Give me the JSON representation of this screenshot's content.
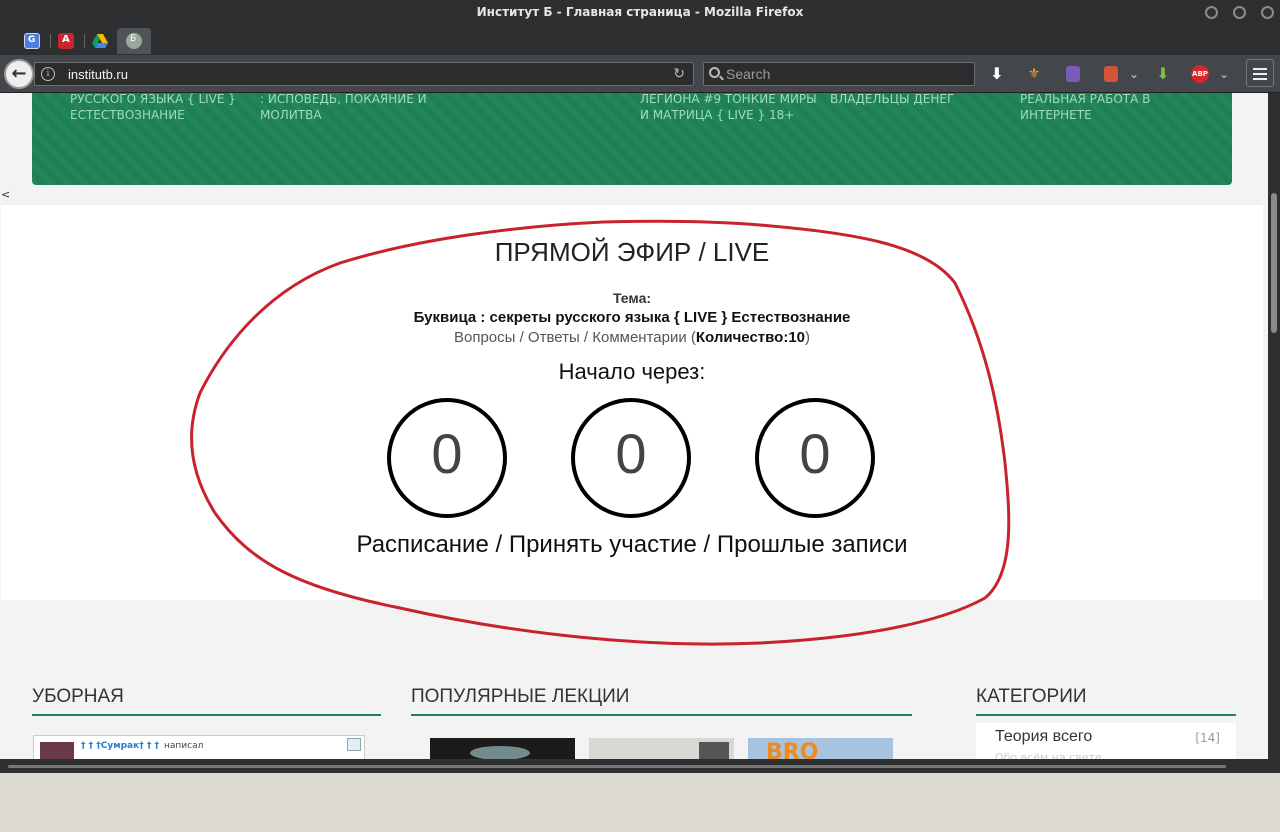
{
  "window": {
    "title": "Институт Б - Главная страница - Mozilla Firefox"
  },
  "tabs": [
    {
      "icon": "google-translate-icon"
    },
    {
      "icon": "acrobat-icon"
    },
    {
      "icon": "google-drive-icon"
    },
    {
      "icon": "site-favicon",
      "active": true
    }
  ],
  "toolbar": {
    "url": "institutb.ru",
    "search_placeholder": "Search",
    "icons": [
      "download-icon",
      "extension-icon",
      "extension-icon",
      "extension-icon",
      "download-helper-icon",
      "adblock-icon",
      "menu-icon"
    ],
    "adblock_label": "ABP"
  },
  "banner": {
    "items": [
      "РУССКОГО ЯЗЫКА { LIVE } ЕСТЕСТВОЗНАНИЕ",
      ": ИСПОВЕДЬ, ПОКАЯНИЕ И МОЛИТВА",
      "ЛЕГИОНА #9 ТОНКИЕ МИРЫ И МАТРИЦА { LIVE } 18+",
      "ВЛАДЕЛЬЦЫ ДЕНЕГ",
      "РЕАЛЬНАЯ РАБОТА В ИНТЕРНЕТЕ"
    ],
    "prev_arrow": "<"
  },
  "live": {
    "title": "ПРЯМОЙ ЭФИР / LIVE",
    "theme_label": "Тема:",
    "theme": "Буквица : секреты русского языка { LIVE } Естествознание",
    "qa_text": "Вопросы / Ответы / Комментарии (",
    "qa_count": "Количество:10",
    "qa_close": ")",
    "starts_in": "Начало через:",
    "counters": [
      "0",
      "0",
      "0"
    ],
    "links": {
      "schedule": "Расписание",
      "participate": "Принять участие",
      "past": "Прошлые записи",
      "sep": " / "
    }
  },
  "sections": {
    "left": "УБОРНАЯ",
    "middle": "ПОПУЛЯРНЫЕ ЛЕКЦИИ",
    "right": "КАТЕГОРИИ"
  },
  "chat": {
    "user": "† † †Сумрак† † †",
    "wrote": "написал"
  },
  "categories": [
    {
      "name": "Теория всего",
      "count": "[14]",
      "sub": "Обо всём на свете"
    }
  ],
  "colors": {
    "accent_green": "#1e8356",
    "annotation_red": "#c8232c"
  }
}
